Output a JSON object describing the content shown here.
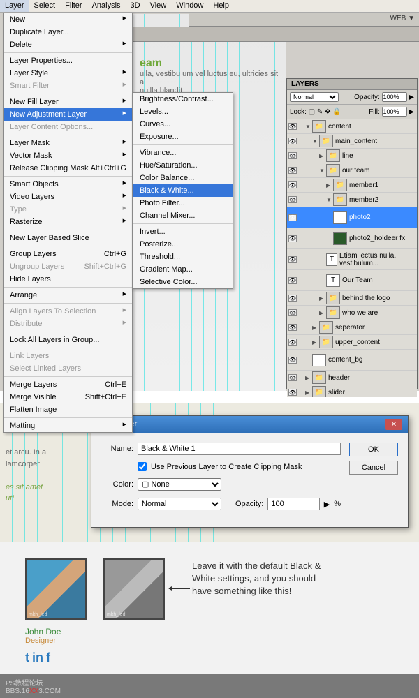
{
  "menubar": [
    "Layer",
    "Select",
    "Filter",
    "Analysis",
    "3D",
    "View",
    "Window",
    "Help"
  ],
  "toolbar_right": "WEB ▼",
  "canvas": {
    "title": "eam",
    "lorem": "ulla, vestibu um vel luctus eu, ultricies sit a",
    "lorem2": "ngilla blandit"
  },
  "menu1": [
    {
      "t": "New",
      "arr": true
    },
    {
      "t": "Duplicate Layer..."
    },
    {
      "t": "Delete",
      "arr": true
    },
    "-",
    {
      "t": "Layer Properties..."
    },
    {
      "t": "Layer Style",
      "arr": true
    },
    {
      "t": "Smart Filter",
      "arr": true,
      "dis": true
    },
    "-",
    {
      "t": "New Fill Layer",
      "arr": true
    },
    {
      "t": "New Adjustment Layer",
      "arr": true,
      "hl": true
    },
    {
      "t": "Layer Content Options...",
      "dis": true
    },
    "-",
    {
      "t": "Layer Mask",
      "arr": true
    },
    {
      "t": "Vector Mask",
      "arr": true
    },
    {
      "t": "Release Clipping Mask",
      "sc": "Alt+Ctrl+G"
    },
    "-",
    {
      "t": "Smart Objects",
      "arr": true
    },
    {
      "t": "Video Layers",
      "arr": true
    },
    {
      "t": "Type",
      "arr": true,
      "dis": true
    },
    {
      "t": "Rasterize",
      "arr": true
    },
    "-",
    {
      "t": "New Layer Based Slice"
    },
    "-",
    {
      "t": "Group Layers",
      "sc": "Ctrl+G"
    },
    {
      "t": "Ungroup Layers",
      "sc": "Shift+Ctrl+G",
      "dis": true
    },
    {
      "t": "Hide Layers"
    },
    "-",
    {
      "t": "Arrange",
      "arr": true
    },
    "-",
    {
      "t": "Align Layers To Selection",
      "arr": true,
      "dis": true
    },
    {
      "t": "Distribute",
      "arr": true,
      "dis": true
    },
    "-",
    {
      "t": "Lock All Layers in Group..."
    },
    "-",
    {
      "t": "Link Layers",
      "dis": true
    },
    {
      "t": "Select Linked Layers",
      "dis": true
    },
    "-",
    {
      "t": "Merge Layers",
      "sc": "Ctrl+E"
    },
    {
      "t": "Merge Visible",
      "sc": "Shift+Ctrl+E"
    },
    {
      "t": "Flatten Image"
    },
    "-",
    {
      "t": "Matting",
      "arr": true
    }
  ],
  "menu2": [
    {
      "t": "Brightness/Contrast..."
    },
    {
      "t": "Levels..."
    },
    {
      "t": "Curves..."
    },
    {
      "t": "Exposure..."
    },
    "-",
    {
      "t": "Vibrance..."
    },
    {
      "t": "Hue/Saturation..."
    },
    {
      "t": "Color Balance..."
    },
    {
      "t": "Black & White...",
      "hl": true
    },
    {
      "t": "Photo Filter..."
    },
    {
      "t": "Channel Mixer..."
    },
    "-",
    {
      "t": "Invert..."
    },
    {
      "t": "Posterize..."
    },
    {
      "t": "Threshold..."
    },
    {
      "t": "Gradient Map..."
    },
    {
      "t": "Selective Color..."
    }
  ],
  "layers_panel": {
    "tab": "LAYERS",
    "blend": "Normal",
    "opacity_label": "Opacity:",
    "opacity": "100%",
    "lock_label": "Lock:",
    "fill_label": "Fill:",
    "fill": "100%",
    "items": [
      {
        "ind": 1,
        "fold": "▼",
        "icon": "folder",
        "name": "content"
      },
      {
        "ind": 2,
        "fold": "▼",
        "icon": "folder",
        "name": "main_content"
      },
      {
        "ind": 3,
        "fold": "▶",
        "icon": "folder",
        "name": "line"
      },
      {
        "ind": 3,
        "fold": "▼",
        "icon": "folder",
        "name": "our team"
      },
      {
        "ind": 4,
        "fold": "▶",
        "icon": "folder",
        "name": "member1"
      },
      {
        "ind": 4,
        "fold": "▼",
        "icon": "folder",
        "name": "member2"
      },
      {
        "ind": 5,
        "icon": "img",
        "name": "photo2",
        "sel": true,
        "big": true
      },
      {
        "ind": 5,
        "icon": "shape",
        "name": "photo2_holdeer",
        "fx": true,
        "big": true
      },
      {
        "ind": 4,
        "icon": "T",
        "name": "Etiam lectus nulla, vestibulum...",
        "big": true
      },
      {
        "ind": 4,
        "icon": "T",
        "name": "Our Team",
        "big": true
      },
      {
        "ind": 3,
        "fold": "▶",
        "icon": "folder",
        "name": "behind the logo"
      },
      {
        "ind": 3,
        "fold": "▶",
        "icon": "folder",
        "name": "who we are"
      },
      {
        "ind": 2,
        "fold": "▶",
        "icon": "folder",
        "name": "seperator"
      },
      {
        "ind": 2,
        "fold": "▶",
        "icon": "folder",
        "name": "upper_content"
      },
      {
        "ind": 2,
        "icon": "blank",
        "name": "content_bg",
        "big": true
      },
      {
        "ind": 1,
        "fold": "▶",
        "icon": "folder",
        "name": "header"
      },
      {
        "ind": 1,
        "fold": "▶",
        "icon": "folder",
        "name": "slider"
      }
    ]
  },
  "dialog": {
    "title": "New Layer",
    "name_label": "Name:",
    "name_value": "Black & White 1",
    "clip_label": "Use Previous Layer to Create Clipping Mask",
    "color_label": "Color:",
    "color_value": "None",
    "mode_label": "Mode:",
    "mode_value": "Normal",
    "opacity_label": "Opacity:",
    "opacity_value": "100",
    "pct": "%",
    "ok": "OK",
    "cancel": "Cancel"
  },
  "lorem_bottom": {
    "l1": "et arcu. In a",
    "l2": "lamcorper",
    "l3": "es sit amet",
    "l4": "ut!"
  },
  "caption": "Leave it with the default Black & White settings, and you should have something like this!",
  "profile": {
    "name": "John Doe",
    "role": "Designer"
  },
  "socials": [
    "t",
    "in",
    "f"
  ],
  "footer": {
    "a": "PS教程论坛",
    "b": "BBS.16",
    "xx": "XX",
    "c": "3.COM"
  }
}
